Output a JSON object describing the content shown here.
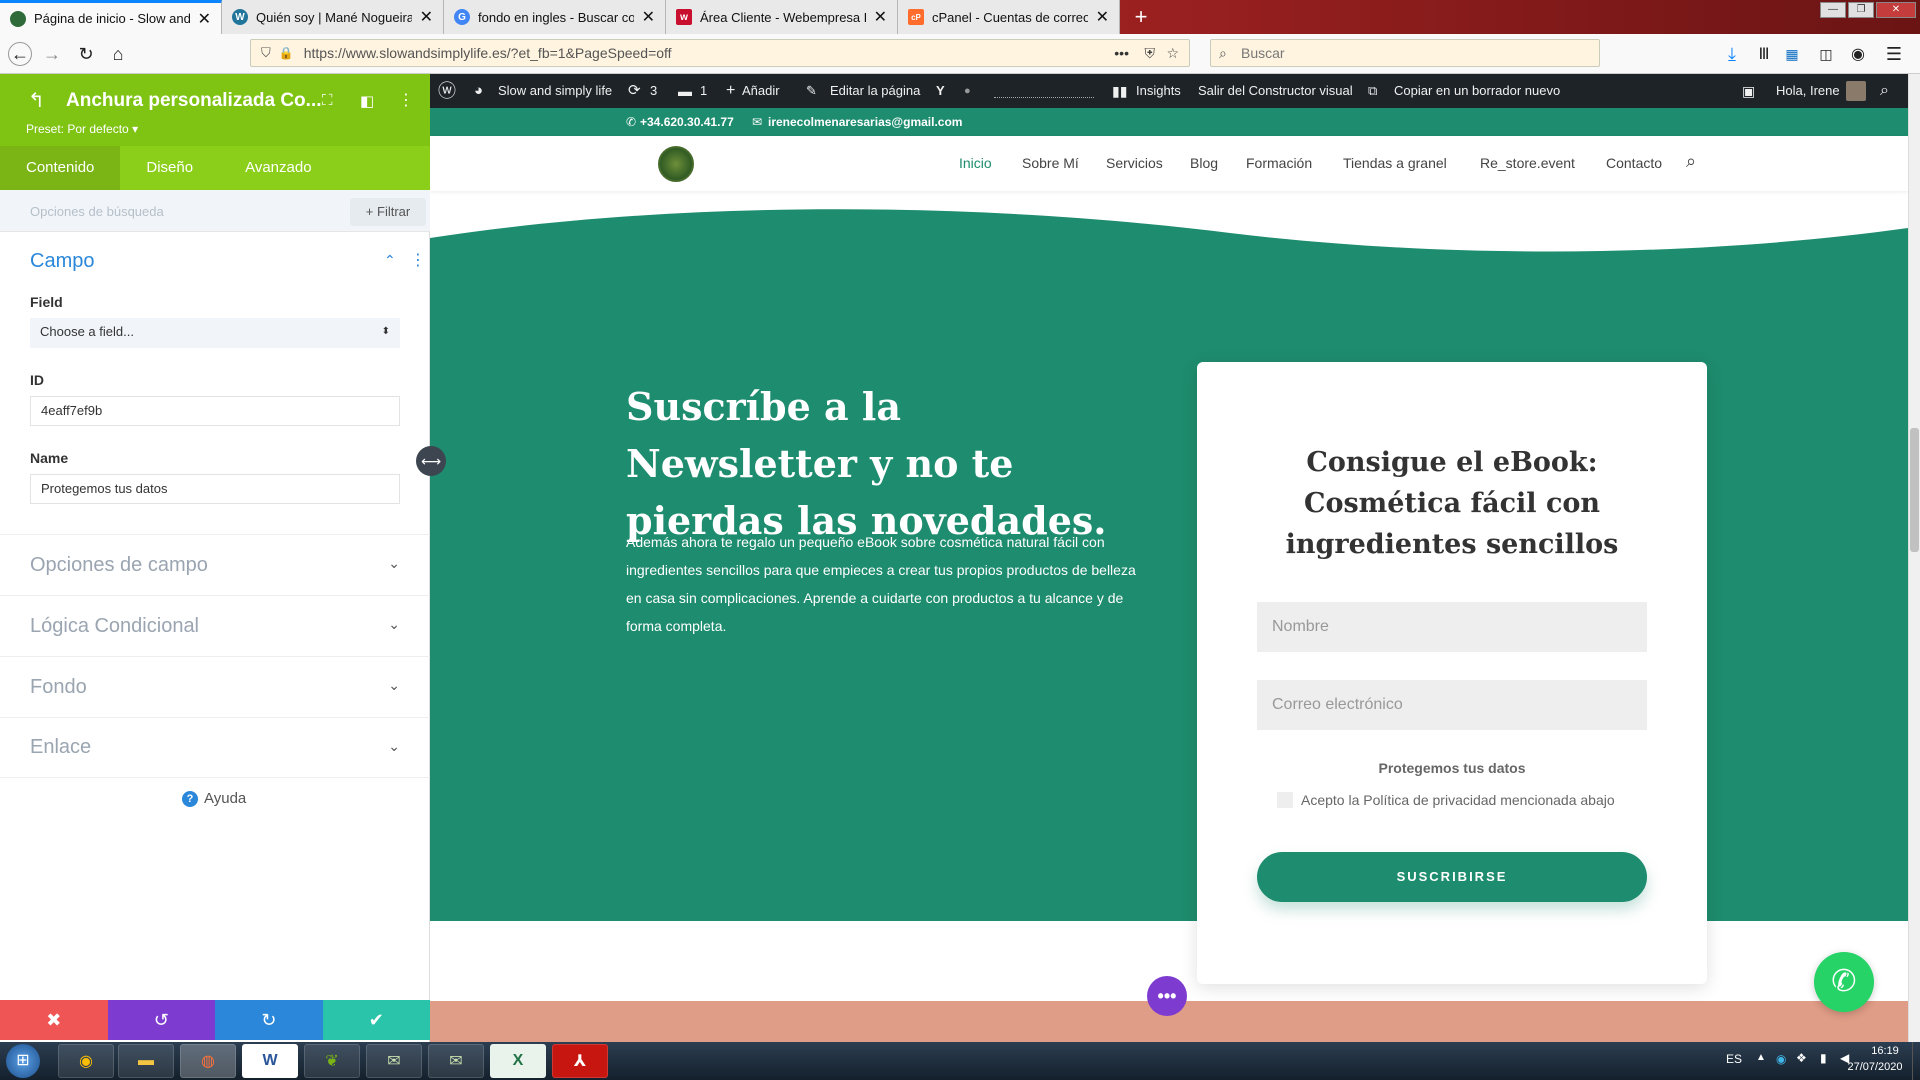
{
  "browser": {
    "tabs": [
      {
        "title": "Página de inicio - Slow and sim",
        "color": "#2f6b3a",
        "glyph": "●"
      },
      {
        "title": "Quién soy | Mané Nogueira",
        "color": "#21759b",
        "glyph": "W"
      },
      {
        "title": "fondo en ingles - Buscar con G",
        "color": "#4285f4",
        "glyph": "G"
      },
      {
        "title": "Área Cliente - Webempresa Eur",
        "color": "#c8102e",
        "glyph": "w"
      },
      {
        "title": "cPanel - Cuentas de correo ele",
        "color": "#ff6c2c",
        "glyph": "cP"
      }
    ],
    "new_tab": "+",
    "url": "https://www.slowandsimplylife.es/?et_fb=1&PageSpeed=off",
    "url_domain": "slowandsimplylife.es",
    "more_dots": "•••",
    "search_placeholder": "Buscar"
  },
  "builder": {
    "back_icon": "back-arrow-icon",
    "title": "Anchura personalizada Co...",
    "preset": "Preset: Por defecto",
    "tabs": [
      "Contenido",
      "Diseño",
      "Avanzado"
    ],
    "search_options": "Opciones de búsqueda",
    "filter_label": "Filtrar",
    "section_campo": "Campo",
    "field_label": "Field",
    "field_select": "Choose a field...",
    "id_label": "ID",
    "id_value": "4eaff7ef9b",
    "name_label": "Name",
    "name_value": "Protegemos tus datos",
    "collapsed_sections": [
      "Opciones de campo",
      "Lógica Condicional",
      "Fondo",
      "Enlace"
    ],
    "help": "Ayuda",
    "accent_color": "#7fc313"
  },
  "wpbar": {
    "site_name": "Slow and simply life",
    "updates": "3",
    "comments": "1",
    "add_new": "Añadir",
    "edit_page": "Editar la página",
    "insights": "Insights",
    "exit_builder": "Salir del Constructor visual",
    "copy_draft": "Copiar en un borrador nuevo",
    "greeting": "Hola, Irene"
  },
  "site": {
    "phone": "+34.620.30.41.77",
    "email": "irenecolmenaresarias@gmail.com",
    "nav": [
      "Inicio",
      "Sobre Mí",
      "Servicios",
      "Blog",
      "Formación",
      "Tiendas a granel",
      "Re_store.event",
      "Contacto"
    ],
    "headline": "Suscríbe a la Newsletter y no te pierdas las novedades.",
    "body_text": "Además ahora te regalo un pequeño eBook sobre cosmética natural fácil con ingredientes sencillos para que empieces a crear tus propios productos de belleza en casa sin complicaciones. Aprende a cuidarte con productos a tu alcance y de forma completa.",
    "card_title": "Consigue el eBook: Cosmética fácil con ingredientes sencillos",
    "input_name": "Nombre",
    "input_email": "Correo electrónico",
    "privacy_heading": "Protegemos tus datos",
    "privacy_checkbox": "Acepto la Política de privacidad mencionada abajo",
    "submit": "SUSCRIBIRSE",
    "brand_color": "#1e8c6e"
  },
  "taskbar": {
    "lang": "ES",
    "time": "16:19",
    "date": "27/07/2020"
  }
}
